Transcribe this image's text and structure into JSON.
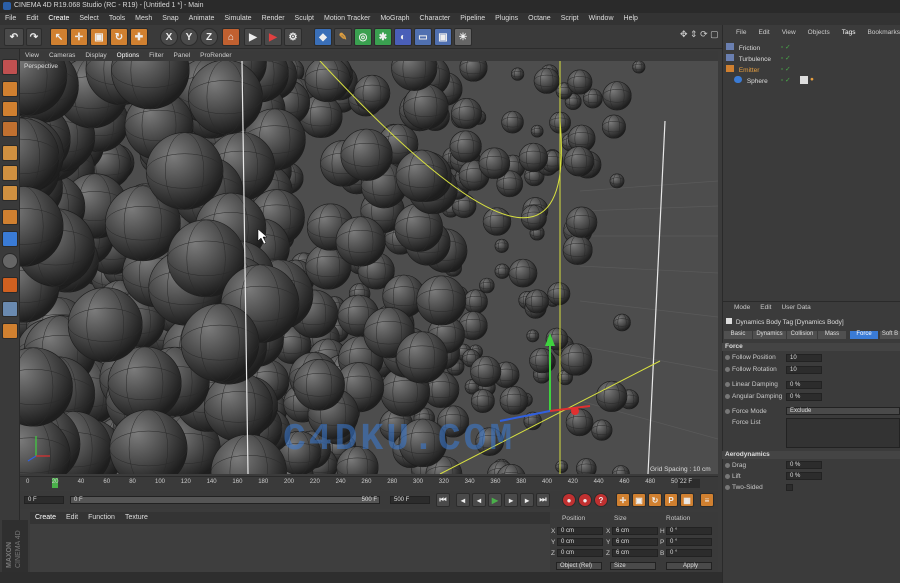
{
  "window": {
    "title": "CINEMA 4D R19.068 Studio (RC - R19) - [Untitled 1 *] - Main"
  },
  "menubar": [
    "File",
    "Edit",
    "Create",
    "Select",
    "Tools",
    "Mesh",
    "Snap",
    "Animate",
    "Simulate",
    "Render",
    "Sculpt",
    "Motion Tracker",
    "MoGraph",
    "Character",
    "Pipeline",
    "Plugins",
    "Octane",
    "Script",
    "Window",
    "Help"
  ],
  "viewport": {
    "menu": [
      "View",
      "Cameras",
      "Display",
      "Options",
      "Filter",
      "Panel",
      "ProRender"
    ],
    "camera_label": "Perspective",
    "grid_spacing": "Grid Spacing : 10 cm",
    "watermark": "C4DKU.COM"
  },
  "timeline": {
    "ticks": [
      "0",
      "20",
      "40",
      "60",
      "80",
      "100",
      "120",
      "140",
      "160",
      "180",
      "200",
      "220",
      "240",
      "260",
      "280",
      "300",
      "320",
      "340",
      "360",
      "380",
      "400",
      "420",
      "440",
      "460",
      "480",
      "500"
    ],
    "current_frame": "22 F",
    "start": "0 F",
    "range_start": "0 F",
    "range_end": "500 F",
    "end": "500 F"
  },
  "material_manager": {
    "menu": [
      "Create",
      "Edit",
      "Function",
      "Texture"
    ]
  },
  "coordinates": {
    "headers": {
      "position": "Position",
      "size": "Size",
      "rotation": "Rotation"
    },
    "rows": [
      {
        "axis": "X",
        "pos": "0 cm",
        "size_axis": "X",
        "size": "6 cm",
        "rot_axis": "H",
        "rot": "0 °"
      },
      {
        "axis": "Y",
        "pos": "0 cm",
        "size_axis": "Y",
        "size": "6 cm",
        "rot_axis": "P",
        "rot": "0 °"
      },
      {
        "axis": "Z",
        "pos": "0 cm",
        "size_axis": "Z",
        "size": "6 cm",
        "rot_axis": "B",
        "rot": "0 °"
      }
    ],
    "mode": "Object (Rel)",
    "size_mode": "Size",
    "apply": "Apply"
  },
  "object_manager": {
    "menu": [
      "File",
      "Edit",
      "View",
      "Objects",
      "Tags",
      "Bookmarks"
    ],
    "objects": [
      {
        "name": "Friction",
        "color": "#d0d0d0"
      },
      {
        "name": "Turbulence",
        "color": "#d0d0d0"
      },
      {
        "name": "Emitter",
        "color": "#e8a040"
      },
      {
        "name": "Sphere",
        "color": "#d0d0d0"
      }
    ]
  },
  "attribute_manager": {
    "menu": [
      "Mode",
      "Edit",
      "User Data"
    ],
    "object_title": "Dynamics Body Tag [Dynamics Body]",
    "tabs": [
      "Basic",
      "Dynamics",
      "Collision",
      "Mass",
      "Force",
      "Soft B"
    ],
    "active_tab": "Force",
    "section_force": "Force",
    "follow_position": {
      "label": "Follow Position",
      "value": "10"
    },
    "follow_rotation": {
      "label": "Follow Rotation",
      "value": "10"
    },
    "linear_damping": {
      "label": "Linear Damping",
      "value": "0 %"
    },
    "angular_damping": {
      "label": "Angular Damping",
      "value": "0 %"
    },
    "force_mode": {
      "label": "Force Mode",
      "value": "Exclude"
    },
    "force_list": {
      "label": "Force List"
    },
    "section_aero": "Aerodynamics",
    "drag": {
      "label": "Drag",
      "value": "0 %"
    },
    "lift": {
      "label": "Lift",
      "value": "0 %"
    },
    "two_sided": {
      "label": "Two-Sided"
    }
  },
  "logo": {
    "line1": "MAXON",
    "line2": "CINEMA 4D"
  },
  "colors": {
    "accent": "#3a7bd5",
    "timeline_marker": "#4ab04a",
    "emitter": "#e8a040",
    "axis_y": "#3fd23f",
    "axis_x": "#e03030",
    "axis_z": "#3060e0"
  }
}
